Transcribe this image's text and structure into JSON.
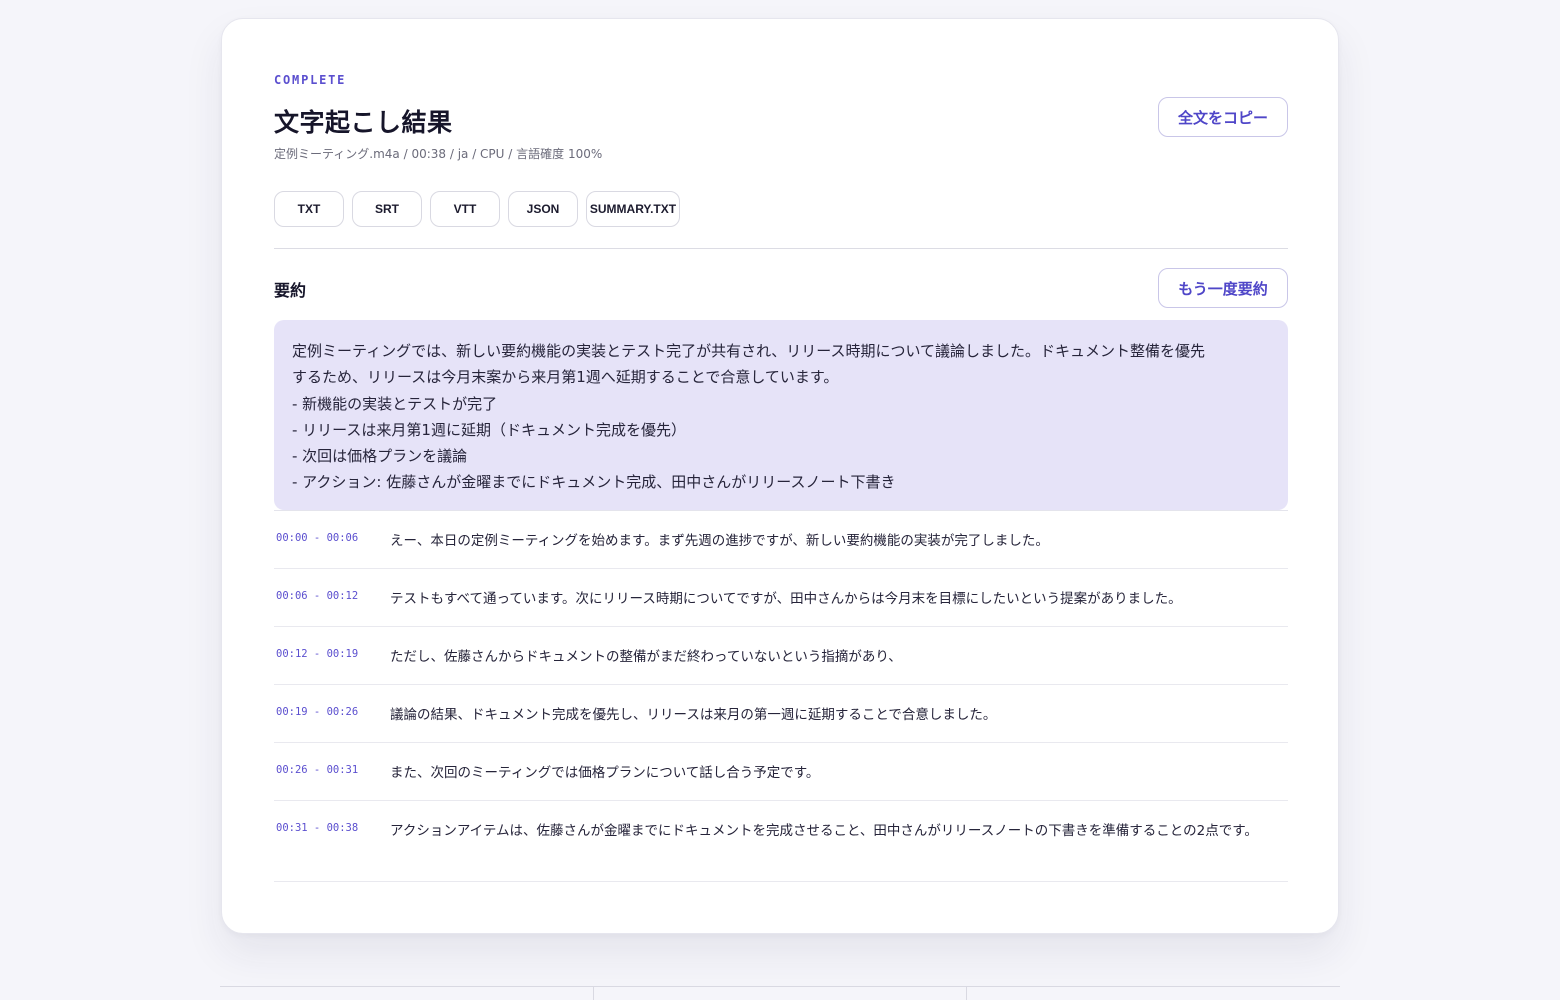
{
  "status_label": "COMPLETE",
  "title": "文字起こし結果",
  "meta": "定例ミーティング.m4a / 00:38 / ja / CPU / 言語確度 100%",
  "copy_all_label": "全文をコピー",
  "formats": [
    "TXT",
    "SRT",
    "VTT",
    "JSON",
    "SUMMARY.TXT"
  ],
  "summary": {
    "heading": "要約",
    "resummarize_label": "もう一度要約",
    "lines": [
      "定例ミーティングでは、新しい要約機能の実装とテスト完了が共有され、リリース時期について議論しました。ドキュメント整備を優先",
      "するため、リリースは今月末案から来月第1週へ延期することで合意しています。",
      "- 新機能の実装とテストが完了",
      "- リリースは来月第1週に延期（ドキュメント完成を優先）",
      "- 次回は価格プランを議論",
      "- アクション: 佐藤さんが金曜までにドキュメント完成、田中さんがリリースノート下書き"
    ]
  },
  "segments": [
    {
      "time": "00:00 - 00:06",
      "text": "えー、本日の定例ミーティングを始めます。まず先週の進捗ですが、新しい要約機能の実装が完了しました。"
    },
    {
      "time": "00:06 - 00:12",
      "text": "テストもすべて通っています。次にリリース時期についてですが、田中さんからは今月末を目標にしたいという提案がありました。"
    },
    {
      "time": "00:12 - 00:19",
      "text": "ただし、佐藤さんからドキュメントの整備がまだ終わっていないという指摘があり、"
    },
    {
      "time": "00:19 - 00:26",
      "text": "議論の結果、ドキュメント完成を優先し、リリースは来月の第一週に延期することで合意しました。"
    },
    {
      "time": "00:26 - 00:31",
      "text": "また、次回のミーティングでは価格プランについて話し合う予定です。"
    },
    {
      "time": "00:31 - 00:38",
      "text": "アクションアイテムは、佐藤さんが金曜までにドキュメントを完成させること、田中さんがリリースノートの下書きを準備することの2点です。"
    }
  ],
  "colors": {
    "accent": "#5b4fcf",
    "summary_bg": "#e6e3f8",
    "page_bg": "#f5f5fa"
  }
}
